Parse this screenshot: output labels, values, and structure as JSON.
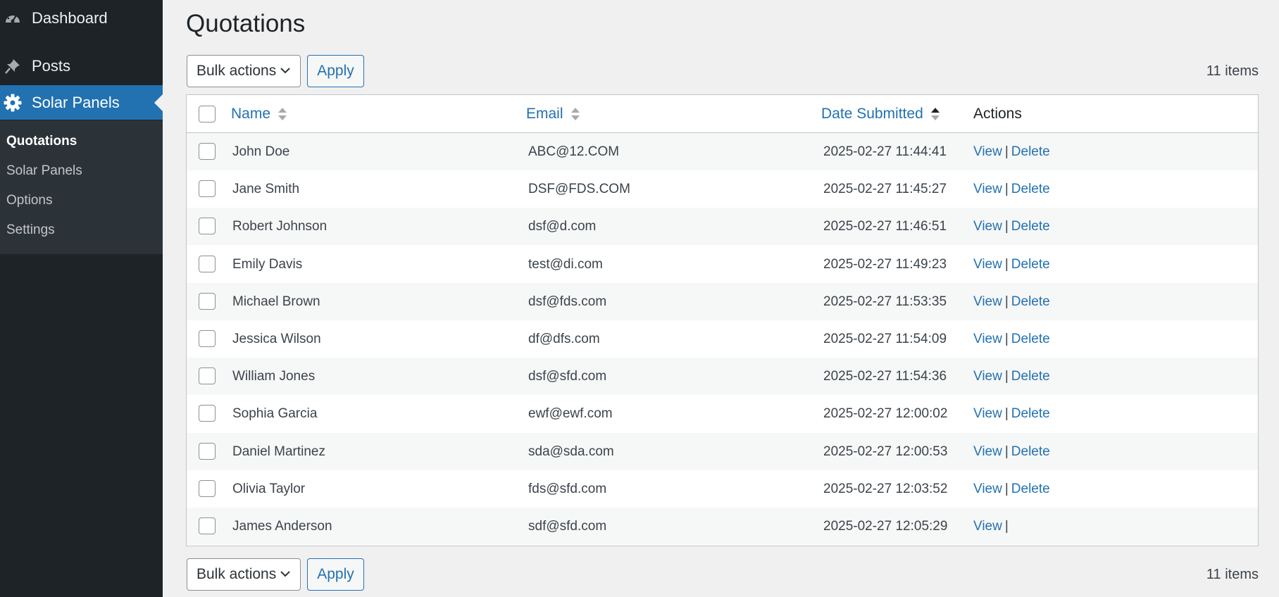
{
  "sidebar": {
    "dashboard": {
      "label": "Dashboard",
      "icon": "dashboard-icon"
    },
    "posts": {
      "label": "Posts",
      "icon": "pin-icon"
    },
    "solar_panels": {
      "label": "Solar Panels",
      "icon": "gear-icon"
    },
    "submenu": [
      {
        "label": "Quotations"
      },
      {
        "label": "Solar Panels"
      },
      {
        "label": "Options"
      },
      {
        "label": "Settings"
      }
    ]
  },
  "page": {
    "title": "Quotations"
  },
  "tablenav": {
    "bulk_label": "Bulk actions",
    "apply_label": "Apply",
    "count": "11 items"
  },
  "table": {
    "headers": {
      "name": "Name",
      "email": "Email",
      "date": "Date Submitted",
      "actions": "Actions"
    },
    "rows": [
      {
        "name": "John Doe",
        "email": "ABC@12.COM",
        "date": "2025-02-27 11:44:41",
        "view": "View",
        "sep": "|",
        "delete": "Delete"
      },
      {
        "name": "Jane Smith",
        "email": "DSF@FDS.COM",
        "date": "2025-02-27 11:45:27",
        "view": "View",
        "sep": "|",
        "delete": "Delete"
      },
      {
        "name": "Robert Johnson",
        "email": "dsf@d.com",
        "date": "2025-02-27 11:46:51",
        "view": "View",
        "sep": "|",
        "delete": "Delete"
      },
      {
        "name": "Emily Davis",
        "email": "test@di.com",
        "date": "2025-02-27 11:49:23",
        "view": "View",
        "sep": "|",
        "delete": "Delete"
      },
      {
        "name": "Michael Brown",
        "email": "dsf@fds.com",
        "date": "2025-02-27 11:53:35",
        "view": "View",
        "sep": "|",
        "delete": "Delete"
      },
      {
        "name": "Jessica Wilson",
        "email": "df@dfs.com",
        "date": "2025-02-27 11:54:09",
        "view": "View",
        "sep": "|",
        "delete": "Delete"
      },
      {
        "name": "William Jones",
        "email": "dsf@sfd.com",
        "date": "2025-02-27 11:54:36",
        "view": "View",
        "sep": "|",
        "delete": "Delete"
      },
      {
        "name": "Sophia Garcia",
        "email": "ewf@ewf.com",
        "date": "2025-02-27 12:00:02",
        "view": "View",
        "sep": "|",
        "delete": "Delete"
      },
      {
        "name": "Daniel Martinez",
        "email": "sda@sda.com",
        "date": "2025-02-27 12:00:53",
        "view": "View",
        "sep": "|",
        "delete": "Delete"
      },
      {
        "name": "Olivia Taylor",
        "email": "fds@sfd.com",
        "date": "2025-02-27 12:03:52",
        "view": "View",
        "sep": "|",
        "delete": "Delete"
      },
      {
        "name": "James Anderson",
        "email": "sdf@sfd.com",
        "date": "2025-02-27 12:05:29",
        "view": "View",
        "sep": "|",
        "delete": ""
      }
    ]
  },
  "colors": {
    "accent": "#2271b1",
    "sidebar": "#1d2327",
    "submenu": "#2c3338"
  }
}
